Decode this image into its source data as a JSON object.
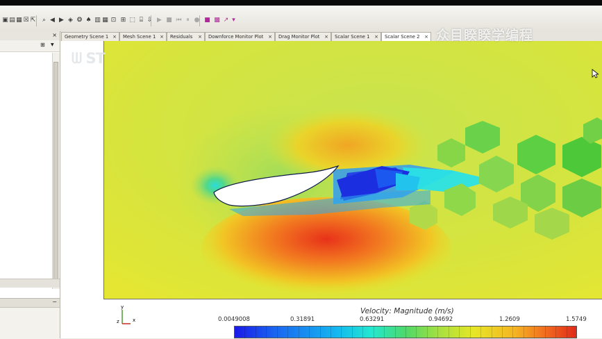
{
  "watermark": {
    "text": "众目睽睽学编程"
  },
  "toolbar": {
    "icons": [
      "save-icon",
      "layout-icon",
      "grid-icon",
      "close-icon",
      "cursor-icon",
      "zoom-icon",
      "arrow-left-icon",
      "arrow-right-icon",
      "cube-icon",
      "palette-icon",
      "bell-icon",
      "table-icon",
      "matrix-icon",
      "vector-icon",
      "target-icon",
      "scene-icon",
      "chart-icon",
      "export-icon",
      "play-icon",
      "stop-icon",
      "step-back-icon",
      "pause-icon",
      "record-icon",
      "magenta-square-icon",
      "magenta-grid-icon",
      "magenta-arrow-icon",
      "magenta-dropdown-icon"
    ]
  },
  "tabs": [
    {
      "label": "Geometry Scene 1",
      "close": "×"
    },
    {
      "label": "Mesh Scene 1",
      "close": "×"
    },
    {
      "label": "Residuals",
      "close": "×"
    },
    {
      "label": "Downforce Monitor Plot",
      "close": "×"
    },
    {
      "label": "Drag Monitor Plot",
      "close": "×"
    },
    {
      "label": "Scalar Scene 1",
      "close": "×"
    },
    {
      "label": "Scalar Scene 2",
      "close": "×"
    }
  ],
  "left_panel": {
    "close": "×",
    "filter_icon": "⊞",
    "dropdown": "▼"
  },
  "scene": {
    "colors": {
      "bg_green": "#b6e060",
      "cyan": "#2ae0e6",
      "blue": "#2f6ef0",
      "red": "#e8321a",
      "yellow": "#e8e628"
    }
  },
  "legend": {
    "title": "Velocity: Magnitude (m/s)",
    "ticks": [
      "0.0049008",
      "0.31891",
      "0.63291",
      "0.94692",
      "1.2609",
      "1.5749"
    ]
  },
  "axes": {
    "y": "y",
    "z": "z",
    "x": "x"
  }
}
